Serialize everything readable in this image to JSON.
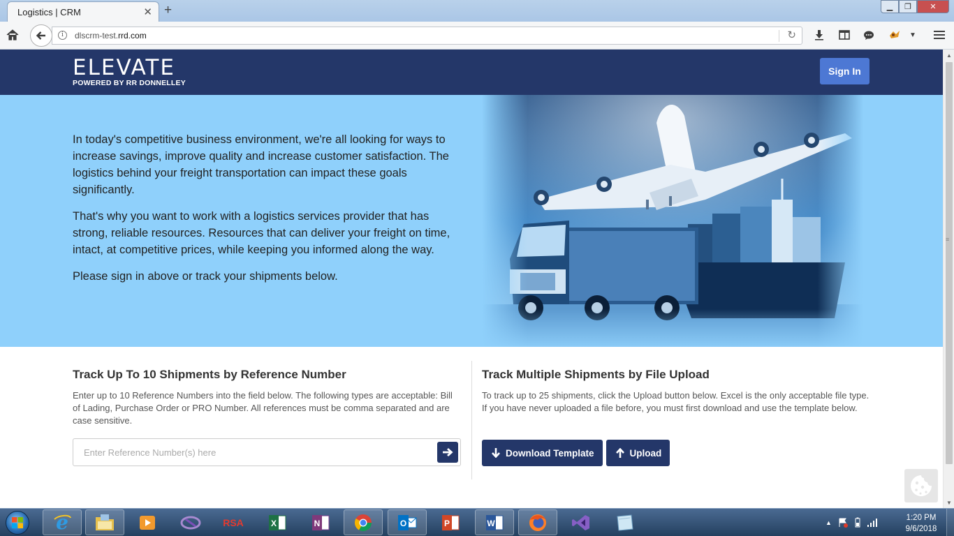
{
  "browser": {
    "tab_title": "Logistics | CRM",
    "url_domain_prefix": "dlscrm-test.",
    "url_domain_main": "rrd.com"
  },
  "header": {
    "logo_text": "ELEVATE",
    "logo_subtitle": "POWERED BY RR DONNELLEY",
    "signin_label": "Sign In"
  },
  "hero": {
    "paragraph1": "In today's competitive business environment, we're all looking for ways to increase savings, improve quality and increase customer satisfaction. The logistics behind your freight transportation can impact these goals significantly.",
    "paragraph2": "That's why you want to work with a logistics services provider that has strong, reliable resources. Resources that can deliver your freight on time, intact, at competitive prices, while keeping you informed along the way.",
    "paragraph3": "Please sign in above or track your shipments below."
  },
  "track_reference": {
    "title": "Track Up To 10 Shipments by Reference Number",
    "description": "Enter up to 10 Reference Numbers into the field below. The following types are acceptable: Bill of Lading, Purchase Order or PRO Number. All references must be comma separated and are case sensitive.",
    "input_value": "",
    "input_placeholder": "Enter Reference Number(s) here"
  },
  "track_upload": {
    "title": "Track Multiple Shipments by File Upload",
    "description": "To track up to 25 shipments, click the Upload button below. Excel is the only acceptable file type. If you have never uploaded a file before, you must first download and use the template below.",
    "download_label": "Download Template",
    "upload_label": "Upload"
  },
  "taskbar": {
    "apps": [
      "internet-explorer-icon",
      "file-explorer-icon",
      "media-player-icon",
      "visual-studio-blend-icon",
      "rsa-icon",
      "excel-icon",
      "onenote-icon",
      "chrome-icon",
      "outlook-icon",
      "powerpoint-icon",
      "word-icon",
      "firefox-icon",
      "visual-studio-icon",
      "sticky-notes-icon"
    ],
    "rsa_label": "RSA",
    "time": "1:20 PM",
    "date": "9/6/2018"
  },
  "colors": {
    "header_navy": "#243769",
    "hero_blue": "#8fd0fb",
    "signin_blue": "#4d78d4",
    "button_navy": "#243769"
  }
}
